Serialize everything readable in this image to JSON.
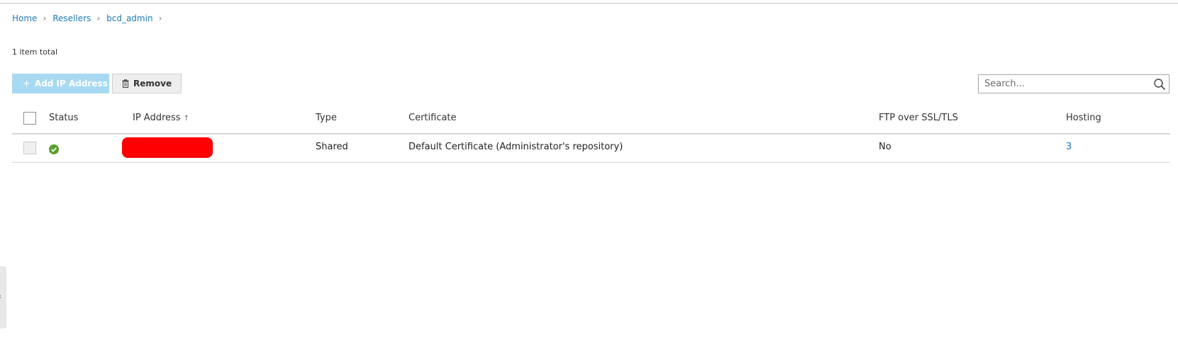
{
  "breadcrumb": {
    "items": [
      "Home",
      "Resellers",
      "bcd_admin"
    ],
    "separator": ">"
  },
  "list": {
    "total_label": "1 item total"
  },
  "toolbar": {
    "add_label": "Add IP Address",
    "add_icon": "plus-icon",
    "remove_label": "Remove",
    "remove_icon": "trash-icon"
  },
  "search": {
    "placeholder": "Search...",
    "icon": "magnifier-icon"
  },
  "table": {
    "columns": [
      "Status",
      "IP Address",
      "Type",
      "Certificate",
      "FTP over SSL/TLS",
      "Hosting"
    ],
    "sort_indicator": "↑",
    "rows": [
      {
        "status": "ok",
        "ip_address": "",
        "type": "Shared",
        "certificate": "Default Certificate (Administrator's repository)",
        "ftp_over_ssl": "No",
        "hosting": "3"
      }
    ]
  },
  "colors": {
    "link": "#1e7ab8",
    "add_button_bg": "#a7daf2",
    "status_ok": "#5a9e2d",
    "redaction": "#ff0000"
  },
  "side_panel": {
    "toggle_icon": "chevron-left-icon"
  }
}
